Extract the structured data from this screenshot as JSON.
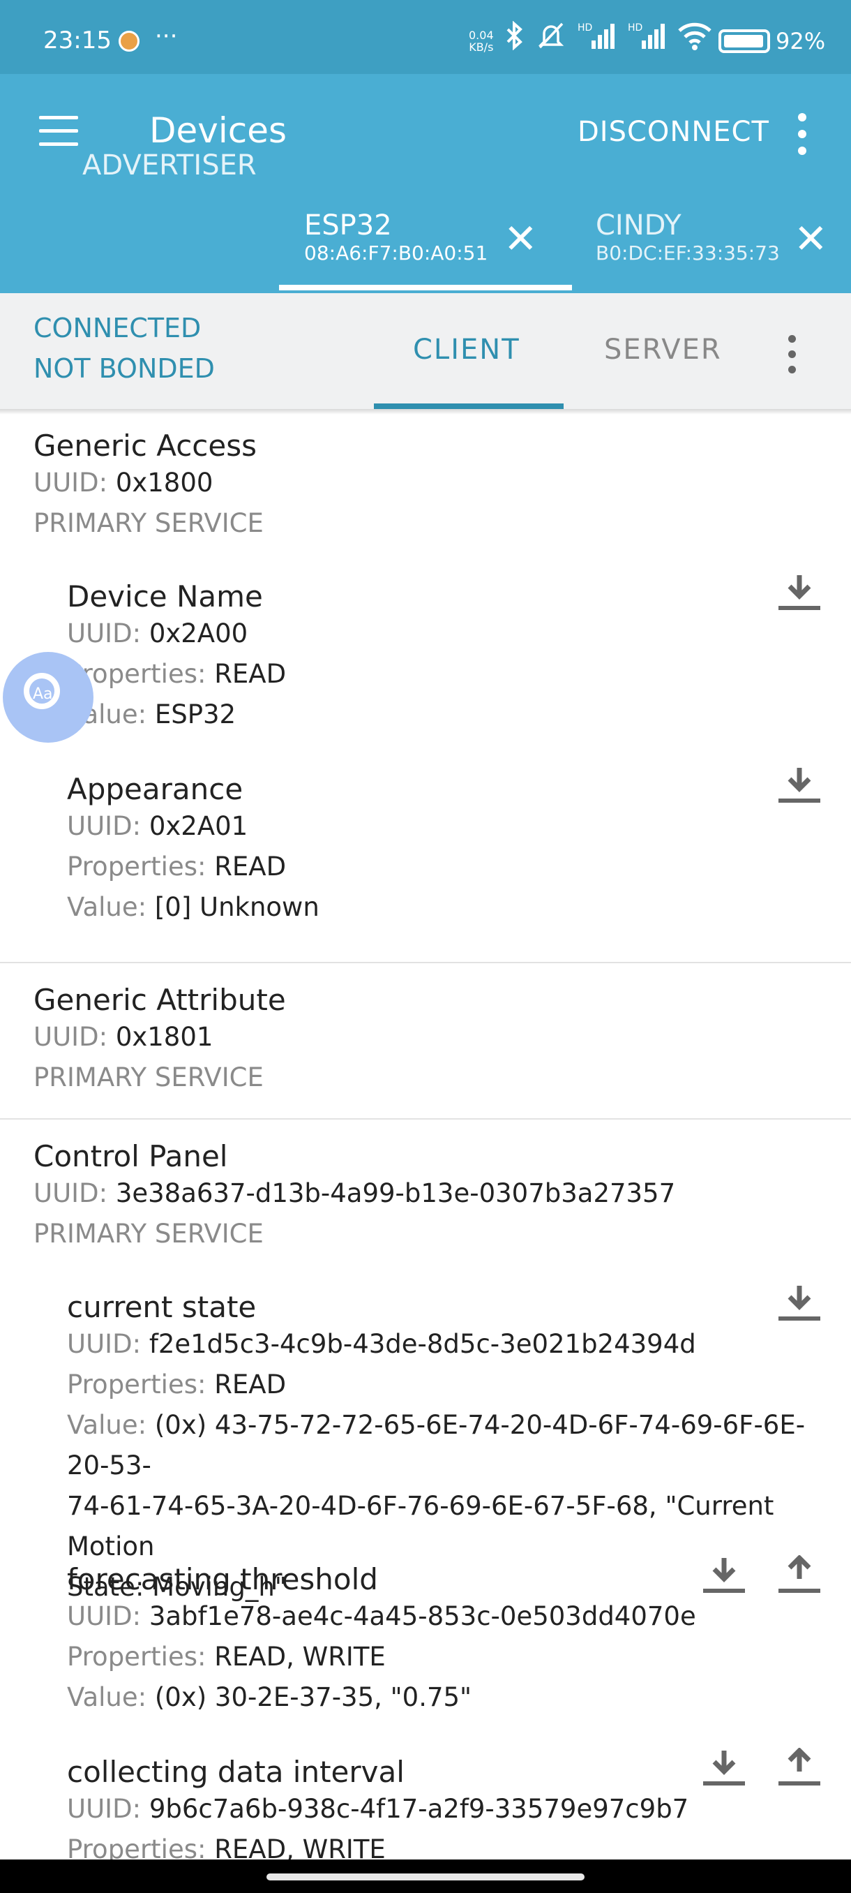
{
  "status_bar": {
    "time": "23:15",
    "more": "···",
    "net_speed_value": "0.04",
    "net_speed_unit": "KB/s",
    "signal_hd_1": "HD",
    "signal_hd_2": "HD",
    "battery": "92%"
  },
  "app_bar": {
    "title": "Devices",
    "disconnect_label": "DISCONNECT"
  },
  "device_tabs": [
    {
      "name": "ADVERTISER"
    },
    {
      "name": "ESP32",
      "mac": "08:A6:F7:B0:A0:51"
    },
    {
      "name": "CINDY",
      "mac": "B0:DC:EF:33:35:73"
    }
  ],
  "connection": {
    "state": "CONNECTED",
    "bond": "NOT BONDED"
  },
  "sub_tabs": {
    "client": "CLIENT",
    "server": "SERVER"
  },
  "labels": {
    "uuid": "UUID:",
    "properties": "Properties:",
    "value": "Value:"
  },
  "services": [
    {
      "name": "Generic Access",
      "uuid": "0x1800",
      "type": "PRIMARY SERVICE",
      "characteristics": [
        {
          "name": "Device Name",
          "uuid": "0x2A00",
          "properties": "READ",
          "value": "ESP32"
        },
        {
          "name": "Appearance",
          "uuid": "0x2A01",
          "properties": "READ",
          "value": "[0] Unknown"
        }
      ]
    },
    {
      "name": "Generic Attribute",
      "uuid": "0x1801",
      "type": "PRIMARY SERVICE",
      "characteristics": []
    },
    {
      "name": "Control Panel",
      "uuid": "3e38a637-d13b-4a99-b13e-0307b3a27357",
      "type": "PRIMARY SERVICE",
      "characteristics": [
        {
          "name": "current state",
          "uuid": "f2e1d5c3-4c9b-43de-8d5c-3e021b24394d",
          "properties": "READ",
          "value_line1": "(0x) 43-75-72-72-65-6E-74-20-4D-6F-74-69-6F-6E-20-53-",
          "value_line2": "74-61-74-65-3A-20-4D-6F-76-69-6E-67-5F-68, \"Current Motion",
          "value_line3": "State: Moving_h\""
        },
        {
          "name": "forecasting threshold",
          "uuid": "3abf1e78-ae4c-4a45-853c-0e503dd4070e",
          "properties": "READ, WRITE",
          "value": "(0x) 30-2E-37-35, \"0.75\""
        },
        {
          "name": "collecting data interval",
          "uuid": "9b6c7a6b-938c-4f17-a2f9-33579e97c9b7",
          "properties": "READ, WRITE"
        }
      ]
    }
  ]
}
